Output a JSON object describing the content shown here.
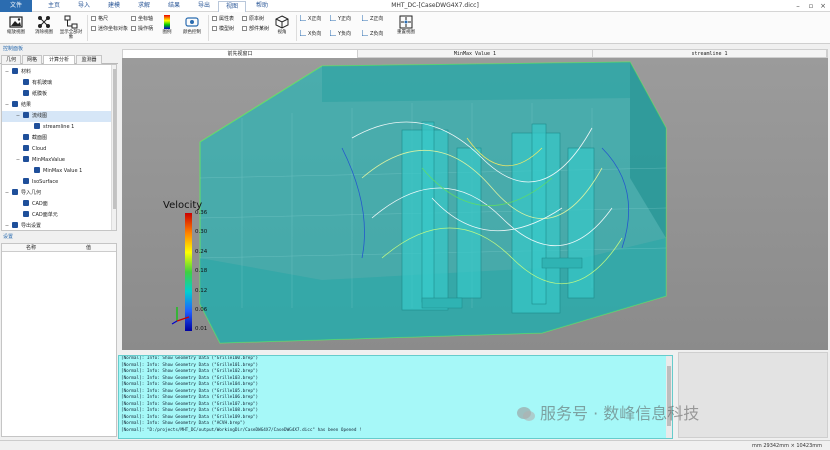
{
  "app": {
    "title": "MHT_DC-[CaseDWG4X7.dicc]",
    "menu_tabs": [
      "文件",
      "主页",
      "导入",
      "建模",
      "求解",
      "结果",
      "导出",
      "视图",
      "帮助"
    ],
    "active_menu_tab": "视图"
  },
  "ribbon": {
    "buttons": [
      "缩放视图",
      "消除视图",
      "显示全部对象",
      "图例",
      "颜色控制",
      "视角",
      "重置视图"
    ],
    "checks_group1": [
      "格尺",
      "坐标轴",
      "迷你坐标对象",
      "最简单的",
      "操作柄"
    ],
    "checks_group2": [
      "属性表",
      "原本树",
      "模型树",
      "部件某树"
    ],
    "view_dirs_top": [
      "X正向",
      "Y正向",
      "Z正向"
    ],
    "view_dirs_bottom": [
      "X负向",
      "Y负向",
      "Z负向"
    ]
  },
  "left_panel": {
    "header": "控制面板",
    "tabs": [
      "几何",
      "网格",
      "计算分析",
      "监测器"
    ],
    "active_tab": "计算分析",
    "tree": [
      {
        "label": "材料",
        "level": 1,
        "toggle": "−"
      },
      {
        "label": "有机玻璃",
        "level": 2,
        "toggle": ""
      },
      {
        "label": "纸膜板",
        "level": 2,
        "toggle": ""
      },
      {
        "label": "结果",
        "level": 1,
        "toggle": "−"
      },
      {
        "label": "流线图",
        "level": 2,
        "toggle": "−",
        "selected": true
      },
      {
        "label": "streamline 1",
        "level": 3,
        "toggle": ""
      },
      {
        "label": "截面图",
        "level": 2,
        "toggle": ""
      },
      {
        "label": "Cloud",
        "level": 2,
        "toggle": ""
      },
      {
        "label": "MinMaxValue",
        "level": 2,
        "toggle": "−"
      },
      {
        "label": "MinMax Value 1",
        "level": 3,
        "toggle": ""
      },
      {
        "label": "IsoSurface",
        "level": 2,
        "toggle": ""
      },
      {
        "label": "导入几何",
        "level": 1,
        "toggle": "−"
      },
      {
        "label": "CAD面",
        "level": 2,
        "toggle": ""
      },
      {
        "label": "CAD面单元",
        "level": 2,
        "toggle": ""
      },
      {
        "label": "导出设置",
        "level": 1,
        "toggle": "−"
      }
    ],
    "props_header": "设置",
    "props_columns": [
      "名称",
      "值"
    ]
  },
  "view_tabs": [
    "前先视窗口",
    "MinMax Value 1",
    "streamline 1"
  ],
  "active_view_tab": "前先视窗口",
  "legend": {
    "title": "Velocity",
    "ticks": [
      "0.36",
      "0.30",
      "0.24",
      "0.18",
      "0.12",
      "0.06",
      "0.01"
    ],
    "colors": [
      "#cc0000",
      "#ff8000",
      "#ffff00",
      "#40d040",
      "#00d0d0",
      "#2060ff",
      "#0000a0"
    ]
  },
  "console_lines": [
    "[Normal]: Info: Show Geometry Data (\"Grille100.brep\")",
    "[Normal]: Info: Show Geometry Data (\"Grille101.brep\")",
    "[Normal]: Info: Show Geometry Data (\"Grille102.brep\")",
    "[Normal]: Info: Show Geometry Data (\"Grille103.brep\")",
    "[Normal]: Info: Show Geometry Data (\"Grille104.brep\")",
    "[Normal]: Info: Show Geometry Data (\"Grille105.brep\")",
    "[Normal]: Info: Show Geometry Data (\"Grille106.brep\")",
    "[Normal]: Info: Show Geometry Data (\"Grille107.brep\")",
    "[Normal]: Info: Show Geometry Data (\"Grille108.brep\")",
    "[Normal]: Info: Show Geometry Data (\"Grille109.brep\")",
    "[Normal]: Info: Show Geometry Data (\"ACVH.brep\")",
    "[Normal]: \"D:/projects/MHT_DC/output/WorkingDir/CaseDWG4X7/CaseDWG4X7.dicc\" has been Opened !"
  ],
  "status": "mm 29342mm × 10423mm",
  "watermark": "服务号 · 数峰信息科技"
}
